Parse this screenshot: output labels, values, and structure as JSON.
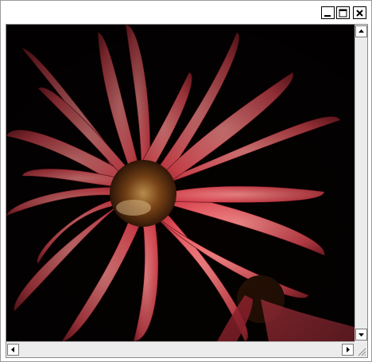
{
  "window": {
    "title": "",
    "controls": {
      "minimize_icon": "minimize-icon",
      "maximize_icon": "maximize-icon",
      "close_icon": "close-icon"
    }
  },
  "image": {
    "subject_icon": "flower-photo",
    "colors": {
      "background": "#050101",
      "petal": "#e8505a",
      "center": "#6b3a10"
    }
  },
  "scrollbars": {
    "vertical": {
      "up_icon": "arrow-up-icon",
      "down_icon": "arrow-down-icon"
    },
    "horizontal": {
      "left_icon": "arrow-left-icon",
      "right_icon": "arrow-right-icon"
    }
  }
}
